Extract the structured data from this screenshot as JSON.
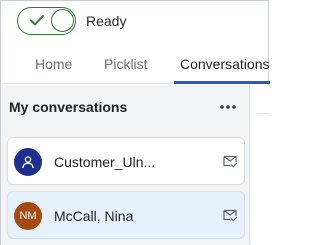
{
  "status": {
    "toggle_on": true,
    "label": "Ready",
    "color": "#2e7d32"
  },
  "tabs": [
    {
      "label": "Home",
      "active": false
    },
    {
      "label": "Picklist",
      "active": false
    },
    {
      "label": "Conversations",
      "active": true
    }
  ],
  "conversations_panel": {
    "title": "My conversations",
    "more_icon": "more-horizontal-icon",
    "items": [
      {
        "name": "Customer_Uln...",
        "avatar_icon": "person-icon",
        "avatar_color": "#1d2f8f",
        "action_icon": "mail-check-icon",
        "selected": false
      },
      {
        "name": "McCall, Nina",
        "avatar_initials": "NM",
        "avatar_color": "#a44a12",
        "action_icon": "mail-check-icon",
        "selected": true
      }
    ]
  },
  "colors": {
    "accent": "#1f5fbf",
    "panel_bg": "#f2f3f5",
    "selected_bg": "#e7f1fb"
  }
}
